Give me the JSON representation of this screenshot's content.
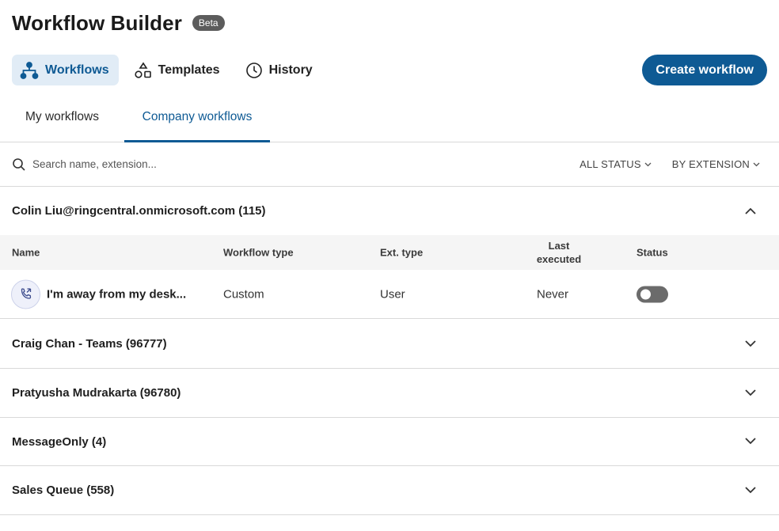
{
  "header": {
    "title": "Workflow Builder",
    "badge": "Beta"
  },
  "nav": {
    "items": [
      {
        "label": "Workflows",
        "icon": "workflow-icon",
        "active": true
      },
      {
        "label": "Templates",
        "icon": "templates-icon",
        "active": false
      },
      {
        "label": "History",
        "icon": "clock-icon",
        "active": false
      }
    ],
    "create_label": "Create workflow"
  },
  "tabs": [
    {
      "label": "My workflows",
      "active": false
    },
    {
      "label": "Company workflows",
      "active": true
    }
  ],
  "search": {
    "placeholder": "Search name, extension..."
  },
  "filters": {
    "status": "ALL STATUS",
    "extension": "BY EXTENSION"
  },
  "groups": [
    {
      "label": "Colin Liu@ringcentral.onmicrosoft.com (115)",
      "expanded": true
    },
    {
      "label": "Craig Chan - Teams (96777)",
      "expanded": false
    },
    {
      "label": "Pratyusha Mudrakarta (96780)",
      "expanded": false
    },
    {
      "label": "MessageOnly (4)",
      "expanded": false
    },
    {
      "label": "Sales Queue (558)",
      "expanded": false
    }
  ],
  "table": {
    "columns": {
      "name": "Name",
      "workflow_type": "Workflow type",
      "ext_type": "Ext. type",
      "last_executed_1": "Last",
      "last_executed_2": "executed",
      "status": "Status"
    },
    "rows": [
      {
        "icon": "phone-forward-icon",
        "name": "I'm away from my desk...",
        "workflow_type": "Custom",
        "ext_type": "User",
        "last_executed": "Never",
        "status_enabled": false
      }
    ]
  },
  "colors": {
    "accent": "#0e5a94",
    "active_nav_bg": "#e1ecf6",
    "badge_bg": "#5c5c5c",
    "toggle_off": "#6b6b6b"
  }
}
